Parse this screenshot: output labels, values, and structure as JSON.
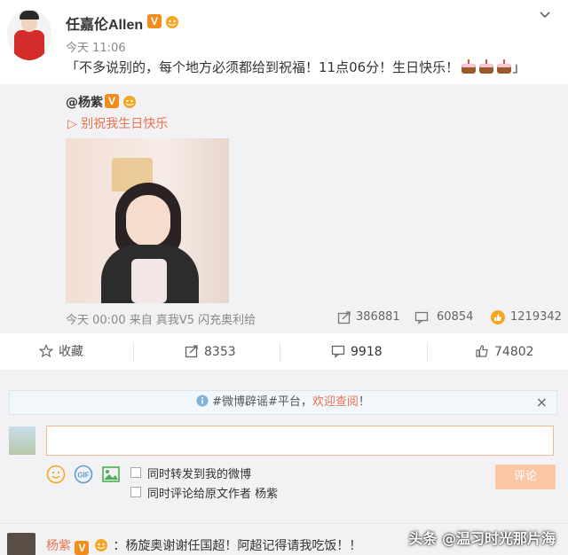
{
  "post": {
    "username": "任嘉伦Allen",
    "time": "今天 11:06",
    "text": "「不多说别的，每个地方必须都给到祝福！11点06分！生日快乐！",
    "text_end": "」"
  },
  "repost": {
    "user": "@杨紫",
    "link": "▷ 别祝我生日快乐",
    "meta": "今天 00:00 来自 真我V5 闪充奥利给",
    "share_count": "386881",
    "comment_count": "60854",
    "like_count": "1219342"
  },
  "actions": {
    "favorite": "收藏",
    "share": "8353",
    "comment": "9918",
    "like": "74802"
  },
  "notice": {
    "prefix": "#微博辟谣#平台，",
    "link": "欢迎查阅",
    "suffix": "！",
    "close": "×"
  },
  "composer": {
    "repost_label": "同时转发到我的微博",
    "comment_label": "同时评论给原文作者 杨紫",
    "submit": "评论"
  },
  "first_comment": {
    "name": "杨紫",
    "text": "：杨旋奥谢谢任国超！阿超记得请我吃饭！！"
  },
  "watermark": "头条 @温习时光那片海",
  "colors": {
    "accent": "#eb7350",
    "vip_badge": "#f08d1c",
    "repost_bg": "#f2f2f5"
  }
}
